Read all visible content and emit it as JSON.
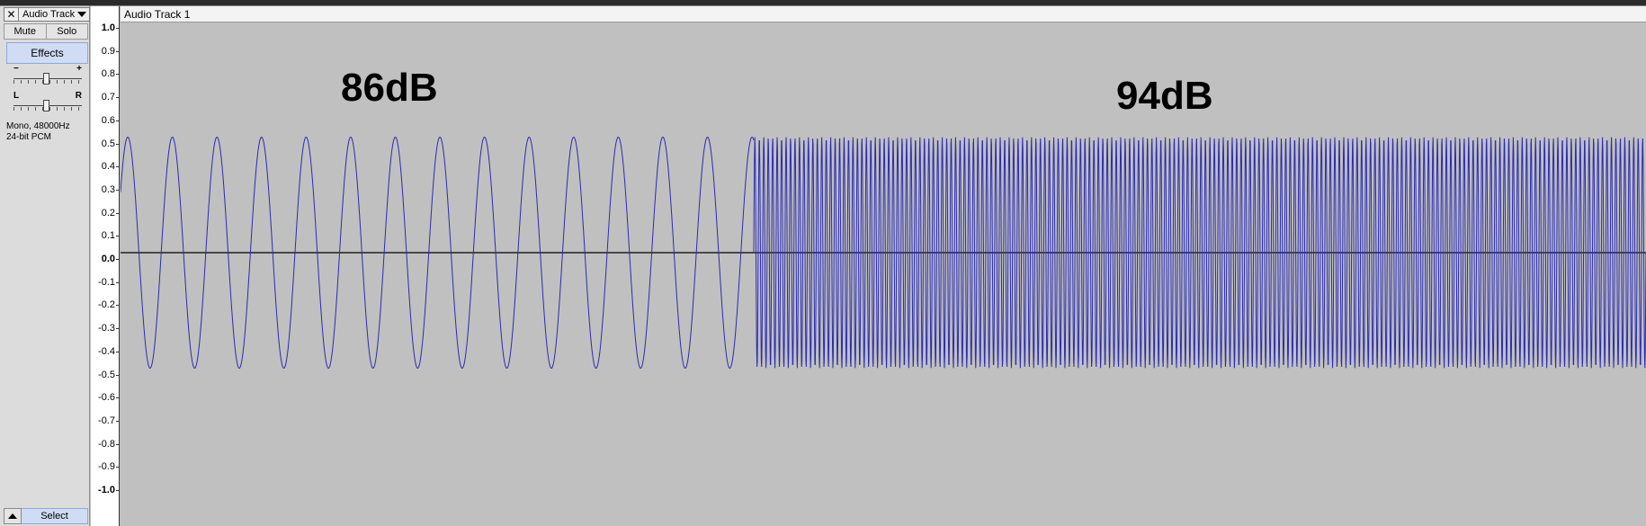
{
  "track": {
    "name": "Audio Track",
    "mute_label": "Mute",
    "solo_label": "Solo",
    "effects_label": "Effects",
    "gain": {
      "minus_label": "−",
      "plus_label": "+"
    },
    "pan": {
      "left_label": "L",
      "right_label": "R"
    },
    "info_line1": "Mono, 48000Hz",
    "info_line2": "24-bit PCM",
    "select_label": "Select",
    "close_symbol": "✕"
  },
  "clip": {
    "title": "Audio Track 1"
  },
  "ruler": {
    "labels": [
      "1.0",
      "0.9",
      "0.8",
      "0.7",
      "0.6",
      "0.5",
      "0.4",
      "0.3",
      "0.2",
      "0.1",
      "0.0",
      "-0.1",
      "-0.2",
      "-0.3",
      "-0.4",
      "-0.5",
      "-0.6",
      "-0.7",
      "-0.8",
      "-0.9",
      "-1.0"
    ]
  },
  "annotations": {
    "left": "86dB",
    "right": "94dB"
  },
  "waveform": {
    "color": "#2b2bb0",
    "amplitude": 0.5,
    "segment1_cycles": 14.2,
    "segment2_cycles": 200
  },
  "colors": {
    "background": "#c0c0c0",
    "panel": "#dcdcdc",
    "button_highlight": "#cfdcf3",
    "zero_line": "#000000"
  },
  "icons": {
    "close": "close-icon",
    "dropdown": "chevron-down-icon",
    "collapse": "chevron-up-icon"
  }
}
